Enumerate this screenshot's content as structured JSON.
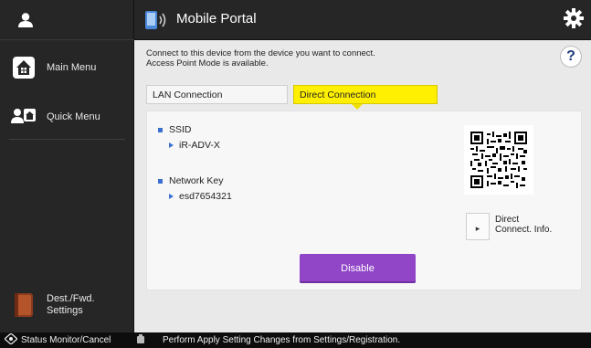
{
  "sidebar": {
    "main_menu": "Main Menu",
    "quick_menu": "Quick Menu",
    "dest_settings_line1": "Dest./Fwd.",
    "dest_settings_line2": "Settings"
  },
  "header": {
    "title": "Mobile Portal"
  },
  "content": {
    "info_line1": "Connect to this device from the device you want to connect.",
    "info_line2": "Access Point Mode is available.",
    "help_label": "?",
    "tabs": {
      "lan": "LAN Connection",
      "direct": "Direct Connection"
    },
    "ssid_label": "SSID",
    "ssid_value": "iR-ADV-X",
    "key_label": "Network Key",
    "key_value": "esd7654321",
    "direct_info_line1": "Direct",
    "direct_info_line2": "Connect. Info.",
    "disable_button": "Disable"
  },
  "statusbar": {
    "monitor": "Status Monitor/Cancel",
    "message": "Perform Apply Setting Changes from Settings/Registration."
  },
  "colors": {
    "accent_yellow": "#ffef00",
    "disable_purple": "#9146c8",
    "bullet_blue": "#3a6fd0"
  }
}
